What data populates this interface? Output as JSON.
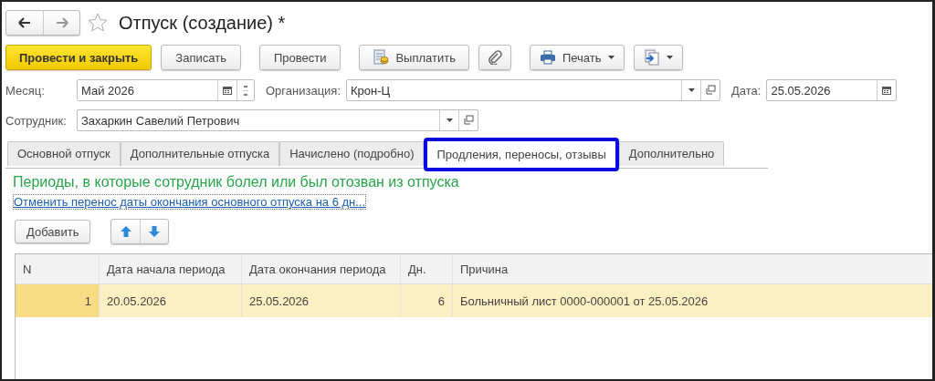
{
  "window": {
    "title": "Отпуск (создание) *",
    "favorite": false
  },
  "toolbar": [
    {
      "kind": "primary",
      "label": "Провести и закрыть"
    },
    {
      "kind": "plain",
      "label": "Записать"
    },
    {
      "kind": "plain",
      "label": "Провести"
    },
    {
      "kind": "pay",
      "label": "Выплатить"
    },
    {
      "kind": "clip"
    },
    {
      "kind": "print",
      "label": "Печать"
    },
    {
      "kind": "export"
    }
  ],
  "fields": {
    "month": {
      "label": "Месяц:",
      "value": "Май 2026"
    },
    "organization": {
      "label": "Организация:",
      "value": "Крон-Ц"
    },
    "date": {
      "label": "Дата:",
      "value": "25.05.2026"
    },
    "employee": {
      "label": "Сотрудник:",
      "value": "Захаркин Савелий Петрович"
    }
  },
  "tabs": [
    {
      "label": "Основной отпуск",
      "selected": false,
      "highlighted": false
    },
    {
      "label": "Дополнительные отпуска",
      "selected": false,
      "highlighted": false
    },
    {
      "label": "Начислено (подробно)",
      "selected": false,
      "highlighted": false
    },
    {
      "label": "Продления, переносы, отзывы",
      "selected": true,
      "highlighted": true
    },
    {
      "label": "Дополнительно",
      "selected": false,
      "highlighted": false
    }
  ],
  "section_title": "Периоды, в которые сотрудник болел или был отозван из отпуска",
  "link": "Отменить перенос даты окончания основного отпуска на 6 дн...",
  "add_button": "Добавить",
  "table": {
    "columns": [
      "N",
      "Дата начала периода",
      "Дата окончания периода",
      "Дн.",
      "Причина"
    ],
    "rows": [
      {
        "cells": [
          "1",
          "20.05.2026",
          "25.05.2026",
          "6",
          "Больничный лист 0000-000001 от 25.05.2026"
        ],
        "selected": true
      }
    ]
  }
}
